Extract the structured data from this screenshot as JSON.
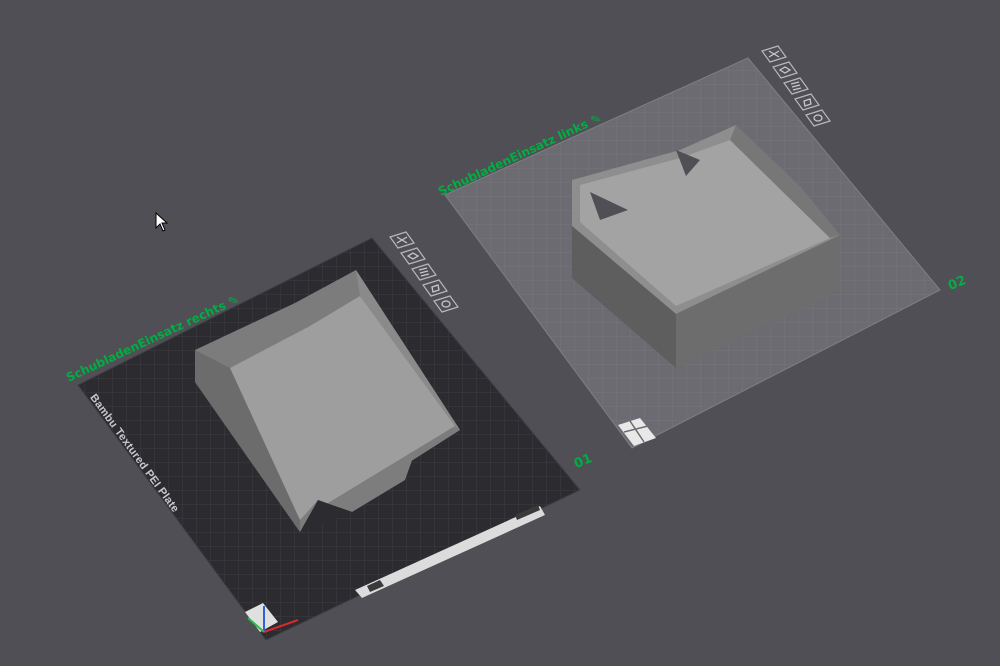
{
  "plates": [
    {
      "label": "SchubladenEinsatz rechts",
      "number": "01",
      "bed_type": "Bambu Textured PEI Plate",
      "style": "dark",
      "tools": [
        "close-icon",
        "auto-orient-icon",
        "arrange-icon",
        "lock-icon",
        "settings-icon"
      ]
    },
    {
      "label": "SchubladenEinsatz links",
      "number": "02",
      "bed_type": "",
      "style": "light",
      "tools": [
        "close-icon",
        "auto-orient-icon",
        "arrange-icon",
        "lock-icon",
        "settings-icon"
      ]
    }
  ],
  "colors": {
    "background": "#4f4f55",
    "accent_green": "#00ae42",
    "dark_bed": "#2b2b30",
    "light_bed": "#6a6a70",
    "model_top": "#9a9a9a",
    "model_side": "#6f6f6f",
    "model_shadow": "#555555"
  },
  "icons": {
    "edit": "pencil-icon",
    "cursor": "mouse-pointer-icon",
    "axes": "axes-gizmo-icon"
  }
}
